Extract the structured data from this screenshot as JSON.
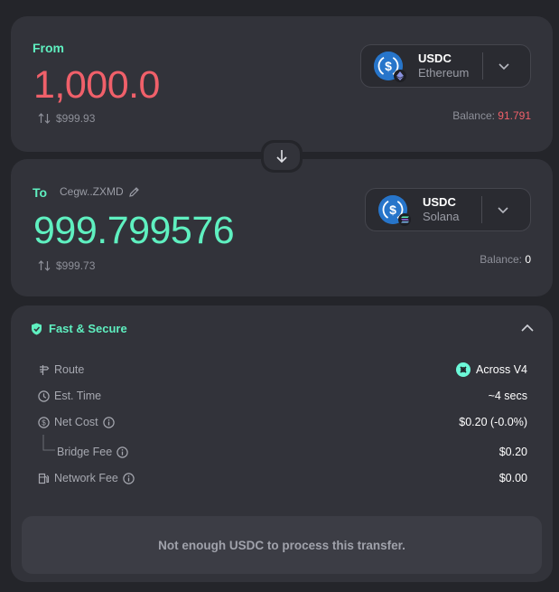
{
  "from": {
    "label": "From",
    "amount": "1,000.0",
    "usd_value": "$999.93",
    "token": {
      "symbol": "USDC",
      "chain": "Ethereum"
    },
    "balance_label": "Balance:",
    "balance_value": "91.791"
  },
  "to": {
    "label": "To",
    "recipient": "Cegw..ZXMD",
    "amount": "999.799576",
    "usd_value": "$999.73",
    "token": {
      "symbol": "USDC",
      "chain": "Solana"
    },
    "balance_label": "Balance:",
    "balance_value": "0"
  },
  "details": {
    "title": "Fast & Secure",
    "rows": {
      "route": {
        "label": "Route",
        "value": "Across V4"
      },
      "est_time": {
        "label": "Est. Time",
        "value": "~4 secs"
      },
      "net_cost": {
        "label": "Net Cost",
        "value": "$0.20 (-0.0%)"
      },
      "bridge_fee": {
        "label": "Bridge Fee",
        "value": "$0.20"
      },
      "network_fee": {
        "label": "Network Fee",
        "value": "$0.00"
      }
    },
    "error": "Not enough USDC to process this transfer."
  },
  "icons": {
    "usdc": "usdc-coin-icon",
    "ethereum": "ethereum-badge-icon",
    "solana": "solana-badge-icon",
    "swap": "arrow-down-icon",
    "edit": "pencil-icon",
    "shield": "shield-check-icon",
    "collapse": "chevron-up-icon",
    "route": "signpost-icon",
    "time": "clock-icon",
    "cost": "dollar-circle-icon",
    "info": "info-icon",
    "fuel": "fuel-pump-icon",
    "across": "across-protocol-icon"
  },
  "colors": {
    "accent": "#5ff0c0",
    "error": "#f0606a",
    "usdc": "#2775ca",
    "card": "#32333a",
    "background": "#24252a"
  }
}
